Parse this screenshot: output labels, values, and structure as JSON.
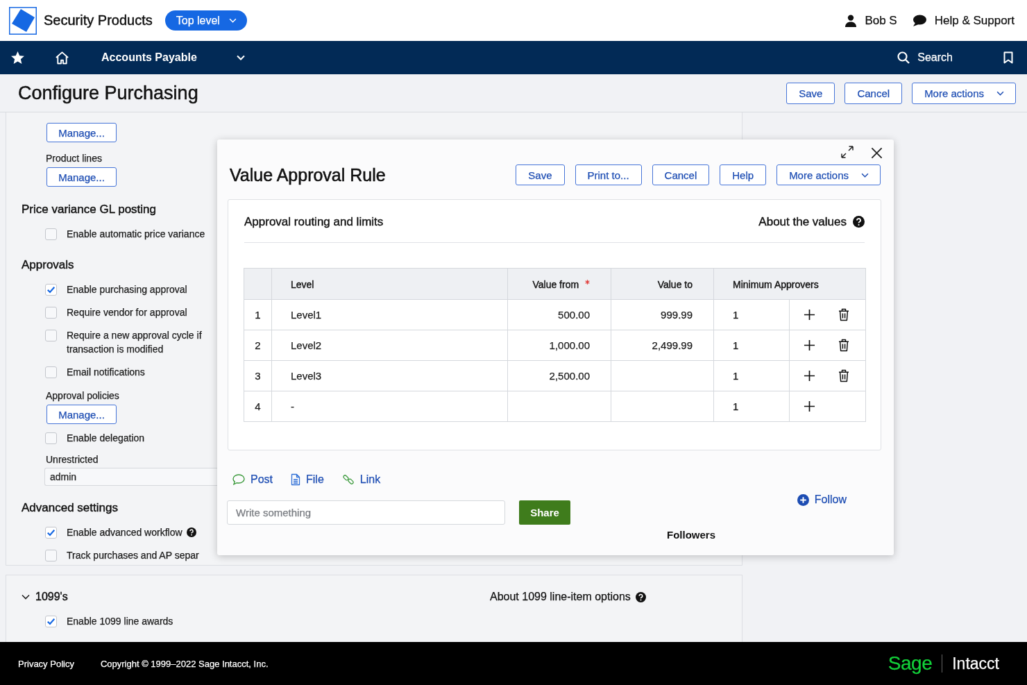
{
  "header": {
    "brand": "Security Products",
    "entity": "Top level",
    "user": "Bob S",
    "help": "Help & Support"
  },
  "nav": {
    "module": "Accounts Payable",
    "search": "Search"
  },
  "page": {
    "title": "Configure Purchasing",
    "actions": [
      {
        "label": "Save",
        "kind": "button"
      },
      {
        "label": "Cancel",
        "kind": "button"
      },
      {
        "label": "More actions",
        "kind": "menu"
      }
    ]
  },
  "settings": [
    {
      "kind": "button",
      "label": "Manage..."
    },
    {
      "kind": "label",
      "text": "Product lines"
    },
    {
      "kind": "button",
      "label": "Manage..."
    },
    {
      "kind": "heading",
      "text": "Price variance GL posting"
    },
    {
      "kind": "checkbox",
      "label": "Enable automatic price variance",
      "checked": false
    },
    {
      "kind": "heading",
      "text": "Approvals"
    },
    {
      "kind": "checkbox",
      "label": "Enable purchasing approval",
      "checked": true
    },
    {
      "kind": "checkbox",
      "label": "Require vendor for approval",
      "checked": false
    },
    {
      "kind": "checkbox",
      "label": "Require a new approval cycle if transaction is modified",
      "checked": false
    },
    {
      "kind": "checkbox",
      "label": "Email notifications",
      "checked": false
    },
    {
      "kind": "label",
      "text": "Approval policies"
    },
    {
      "kind": "button",
      "label": "Manage..."
    },
    {
      "kind": "checkbox",
      "label": "Enable delegation",
      "checked": false
    },
    {
      "kind": "field",
      "label": "Unrestricted",
      "value": "admin"
    },
    {
      "kind": "heading",
      "text": "Advanced settings"
    },
    {
      "kind": "checkbox",
      "label": "Enable advanced workflow",
      "checked": true,
      "help": true
    },
    {
      "kind": "checkbox",
      "label": "Track purchases and AP separ",
      "checked": false
    }
  ],
  "section_1099": {
    "title": "1099's",
    "expanded": true,
    "help_link": "About 1099 line-item options",
    "options": [
      {
        "label": "Enable 1099 line awards",
        "checked": true
      }
    ]
  },
  "dialog": {
    "title": "Value Approval Rule",
    "actions": [
      {
        "label": "Save",
        "kind": "button"
      },
      {
        "label": "Print to...",
        "kind": "button"
      },
      {
        "label": "Cancel",
        "kind": "button"
      },
      {
        "label": "Help",
        "kind": "button"
      },
      {
        "label": "More actions",
        "kind": "menu"
      }
    ],
    "section": {
      "title": "Approval routing and limits",
      "help_link": "About the values"
    },
    "table": {
      "columns": [
        {
          "label": "Level",
          "kind": "text",
          "required": false
        },
        {
          "label": "Value from",
          "kind": "amount",
          "required": true
        },
        {
          "label": "Value to",
          "kind": "amount",
          "required": false
        },
        {
          "label": "Minimum Approvers",
          "kind": "text",
          "required": false
        }
      ],
      "rows": [
        {
          "number": "1",
          "level": "Level1",
          "value_from": "500.00",
          "value_to": "999.99",
          "min_approvers": "1",
          "deletable": true
        },
        {
          "number": "2",
          "level": "Level2",
          "value_from": "1,000.00",
          "value_to": "2,499.99",
          "min_approvers": "1",
          "deletable": true
        },
        {
          "number": "3",
          "level": "Level3",
          "value_from": "2,500.00",
          "min_approvers": "1",
          "deletable": true
        },
        {
          "number": "4",
          "level": "-",
          "min_approvers": "1",
          "deletable": false
        }
      ]
    },
    "feed": {
      "tabs": [
        {
          "label": "Post",
          "kind": "post"
        },
        {
          "label": "File",
          "kind": "file"
        },
        {
          "label": "Link",
          "kind": "link"
        }
      ],
      "input": {
        "placeholder": "Write something"
      },
      "share": "Share",
      "follow": "Follow",
      "followers": "Followers"
    }
  },
  "footer": {
    "links": [
      "Privacy Policy"
    ],
    "copyright": "Copyright © 1999–2022 Sage Intacct, Inc.",
    "brand": "Sage",
    "product": "Intacct"
  }
}
